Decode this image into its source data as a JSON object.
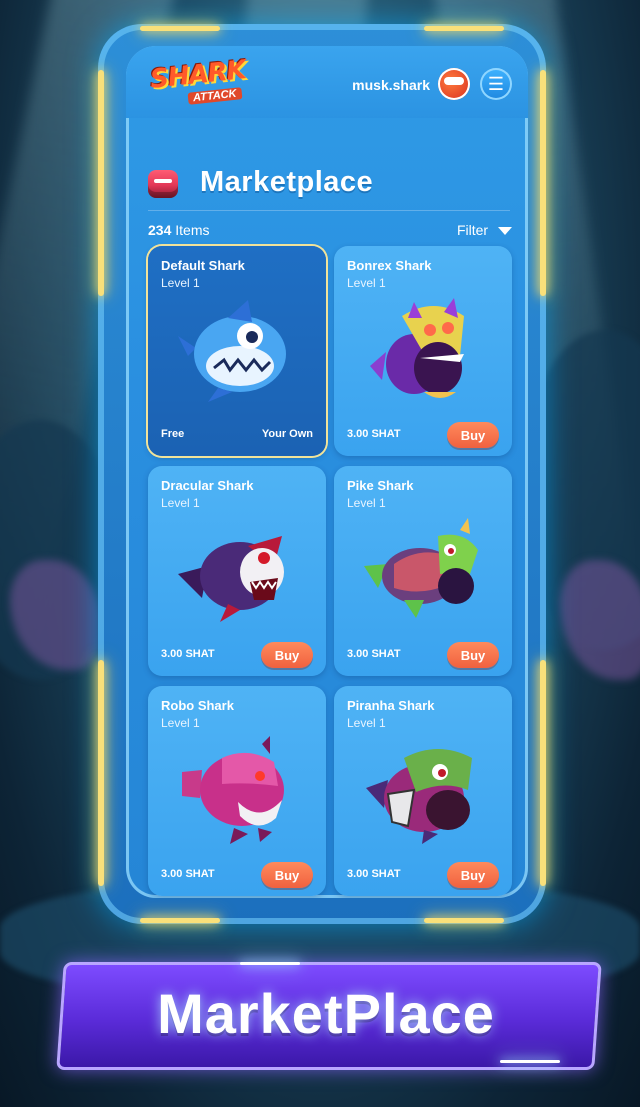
{
  "header": {
    "logo_main": "SHARK",
    "logo_sub": "ATTACK",
    "username": "musk.shark",
    "menu_icon": "☰"
  },
  "marketplace": {
    "title": "Marketplace",
    "item_count": "234",
    "items_label": "Items",
    "filter_label": "Filter"
  },
  "cards": [
    {
      "name": "Default Shark",
      "level": "Level 1",
      "price": "Free",
      "status": "Your Own",
      "owned": true,
      "icon": "blue-shark-icon"
    },
    {
      "name": "Bonrex Shark",
      "level": "Level 1",
      "price": "3.00 SHAT",
      "button": "Buy",
      "owned": false,
      "icon": "bonrex-shark-icon"
    },
    {
      "name": "Dracular Shark",
      "level": "Level 1",
      "price": "3.00 SHAT",
      "button": "Buy",
      "owned": false,
      "icon": "dracular-shark-icon"
    },
    {
      "name": "Pike Shark",
      "level": "Level 1",
      "price": "3.00 SHAT",
      "button": "Buy",
      "owned": false,
      "icon": "pike-shark-icon"
    },
    {
      "name": "Robo Shark",
      "level": "Level 1",
      "price": "3.00 SHAT",
      "button": "Buy",
      "owned": false,
      "icon": "robo-shark-icon"
    },
    {
      "name": "Piranha Shark",
      "level": "Level 1",
      "price": "3.00 SHAT",
      "button": "Buy",
      "owned": false,
      "icon": "piranha-shark-icon"
    }
  ],
  "banner": {
    "text": "MarketPlace"
  },
  "colors": {
    "buy_button": "#f0613f",
    "screen_blue": "#2f9be6",
    "frame_glow": "#f9e07a",
    "banner_purple": "#5a2bd8"
  }
}
